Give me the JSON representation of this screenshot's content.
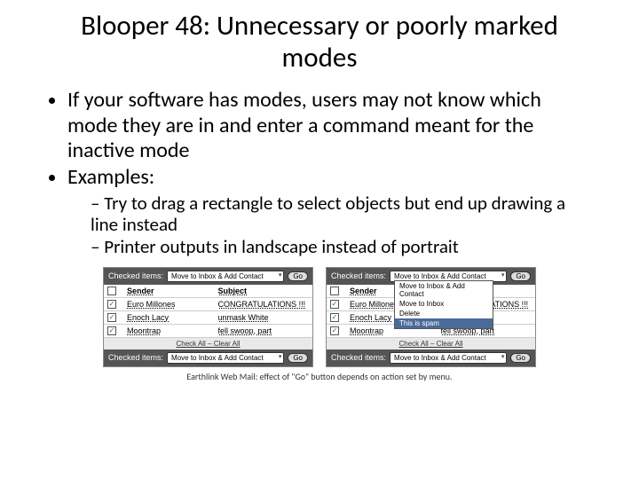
{
  "title": "Blooper 48: Unnecessary or poorly marked modes",
  "bullets": {
    "b1": "If your software has modes, users may not know which mode they are in and enter a command meant for the inactive mode",
    "b2": "Examples:",
    "s1": "Try to drag a rectangle to select objects but end up drawing a line instead",
    "s2": "Printer outputs in landscape instead of portrait"
  },
  "panel": {
    "checkedLabel": "Checked items:",
    "selectValue": "Move to Inbox & Add Contact",
    "goLabel": "Go",
    "headers": {
      "sender": "Sender",
      "subject": "Subject"
    },
    "rows": [
      {
        "checked": false,
        "sender": "Sender",
        "subject": "Subject",
        "hdr": true
      },
      {
        "checked": true,
        "sender": "Euro Millones",
        "subject": "CONGRATULATIONS !!!"
      },
      {
        "checked": true,
        "sender": "Enoch Lacy",
        "subject": "unmask White"
      },
      {
        "checked": true,
        "sender": "Moontrap",
        "subject": "fell swoop, part"
      }
    ],
    "links": "Check All – Clear All",
    "menu": {
      "i1": "Move to Inbox & Add Contact",
      "i2": "Move to Inbox",
      "i3": "Delete",
      "i4": "This is spam"
    }
  },
  "caption": "Earthlink Web Mail: effect of \"Go\" button depends on action set by menu."
}
